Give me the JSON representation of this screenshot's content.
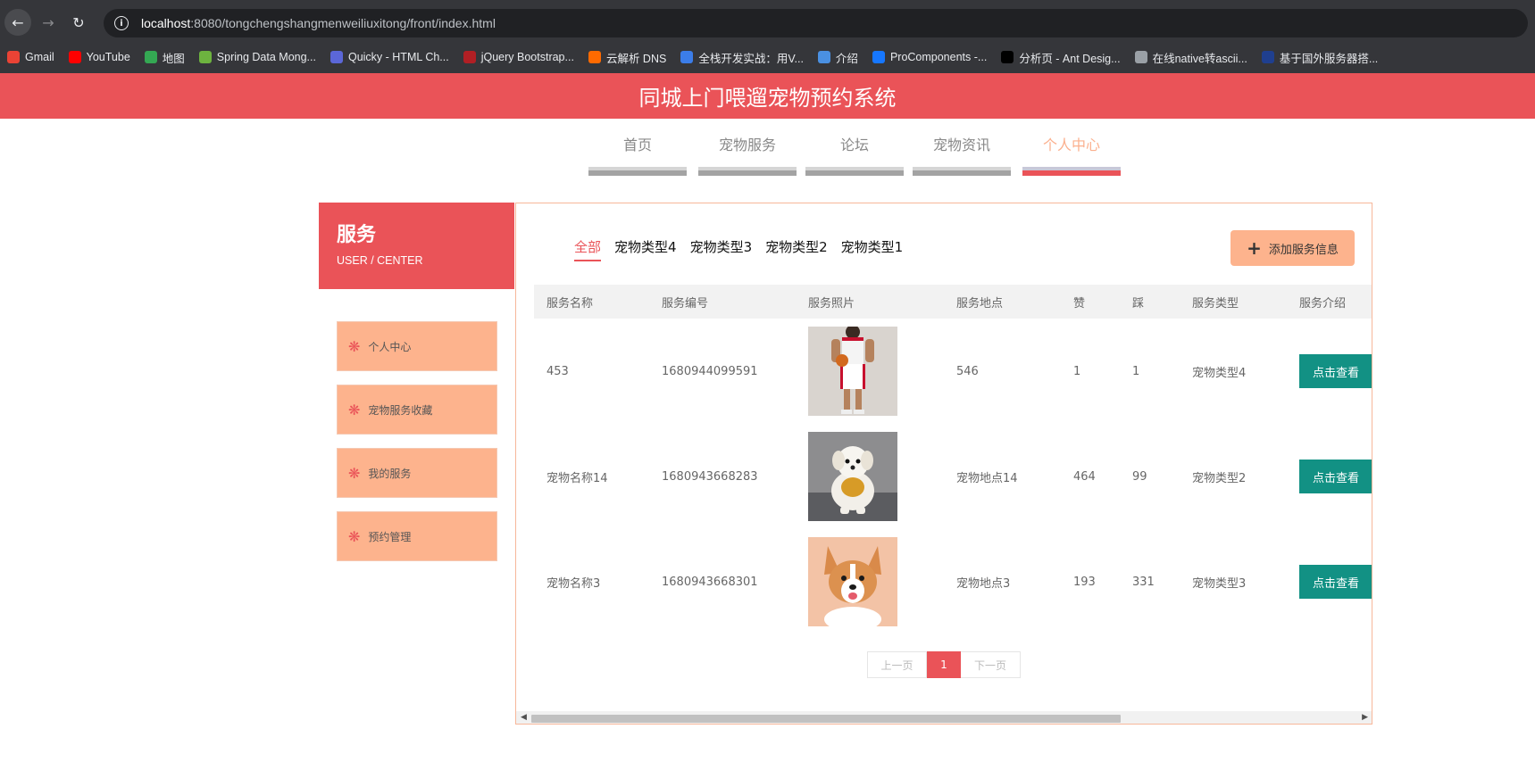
{
  "browser": {
    "url_host": "localhost",
    "url_rest": ":8080/tongchengshangmenweiliuxitong/front/index.html",
    "bookmarks": [
      {
        "label": "Gmail",
        "color": "#ea4335"
      },
      {
        "label": "YouTube",
        "color": "#ff0000"
      },
      {
        "label": "地图",
        "color": "#34a853"
      },
      {
        "label": "Spring Data Mong...",
        "color": "#6db33f"
      },
      {
        "label": "Quicky - HTML Ch...",
        "color": "#5b67d8"
      },
      {
        "label": "jQuery Bootstrap...",
        "color": "#b11f24"
      },
      {
        "label": "云解析 DNS",
        "color": "#ff6a00"
      },
      {
        "label": "全栈开发实战：用V...",
        "color": "#3b7de9"
      },
      {
        "label": "介绍",
        "color": "#4a90e2"
      },
      {
        "label": "ProComponents -...",
        "color": "#1677ff"
      },
      {
        "label": "分析页 - Ant Desig...",
        "color": "#000000"
      },
      {
        "label": "在线native转ascii...",
        "color": "#9aa0a6"
      },
      {
        "label": "基于国外服务器搭...",
        "color": "#1f3f8f"
      }
    ]
  },
  "site": {
    "title": "同城上门喂遛宠物预约系统",
    "accent": "#ea5358",
    "secondary": "#fdb38d"
  },
  "nav": {
    "items": [
      {
        "label": "首页"
      },
      {
        "label": "宠物服务"
      },
      {
        "label": "论坛"
      },
      {
        "label": "宠物资讯"
      },
      {
        "label": "个人中心",
        "active": true
      }
    ]
  },
  "sidebar": {
    "title": "服务",
    "subtitle": "USER / CENTER",
    "items": [
      {
        "label": "个人中心"
      },
      {
        "label": "宠物服务收藏"
      },
      {
        "label": "我的服务"
      },
      {
        "label": "预约管理"
      }
    ]
  },
  "filters": {
    "items": [
      "全部",
      "宠物类型4",
      "宠物类型3",
      "宠物类型2",
      "宠物类型1"
    ],
    "active": "全部"
  },
  "add_button": {
    "label": "添加服务信息"
  },
  "table": {
    "headers": [
      "服务名称",
      "服务编号",
      "服务照片",
      "服务地点",
      "赞",
      "踩",
      "服务类型",
      "服务介绍"
    ],
    "rows": [
      {
        "name": "453",
        "code": "1680944099591",
        "photo": "basketball-player",
        "place": "546",
        "like": "1",
        "dislike": "1",
        "type": "宠物类型4",
        "action": "点击查看"
      },
      {
        "name": "宠物名称14",
        "code": "1680943668283",
        "photo": "white-puppy",
        "place": "宠物地点14",
        "like": "464",
        "dislike": "99",
        "type": "宠物类型2",
        "action": "点击查看"
      },
      {
        "name": "宠物名称3",
        "code": "1680943668301",
        "photo": "corgi",
        "place": "宠物地点3",
        "like": "193",
        "dislike": "331",
        "type": "宠物类型3",
        "action": "点击查看"
      }
    ]
  },
  "pager": {
    "prev": "上一页",
    "current": "1",
    "next": "下一页"
  }
}
